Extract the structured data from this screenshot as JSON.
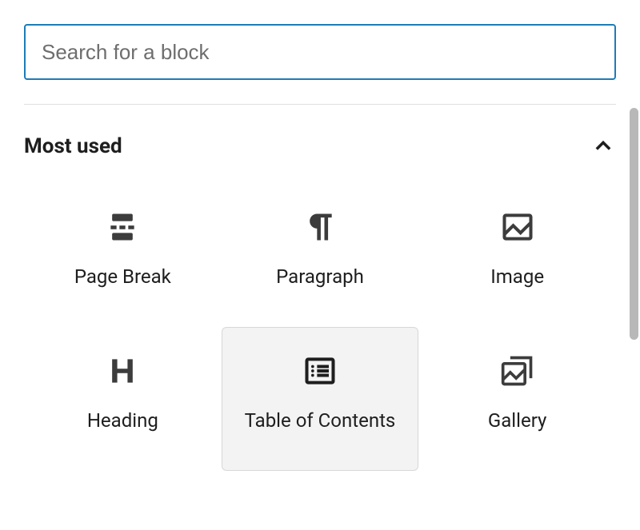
{
  "search": {
    "placeholder": "Search for a block"
  },
  "section": {
    "title": "Most used"
  },
  "blocks": [
    {
      "label": "Page Break",
      "icon": "page-break-icon",
      "selected": false
    },
    {
      "label": "Paragraph",
      "icon": "paragraph-icon",
      "selected": false
    },
    {
      "label": "Image",
      "icon": "image-icon",
      "selected": false
    },
    {
      "label": "Heading",
      "icon": "heading-icon",
      "selected": false
    },
    {
      "label": "Table of Contents",
      "icon": "table-of-contents-icon",
      "selected": true
    },
    {
      "label": "Gallery",
      "icon": "gallery-icon",
      "selected": false
    }
  ]
}
